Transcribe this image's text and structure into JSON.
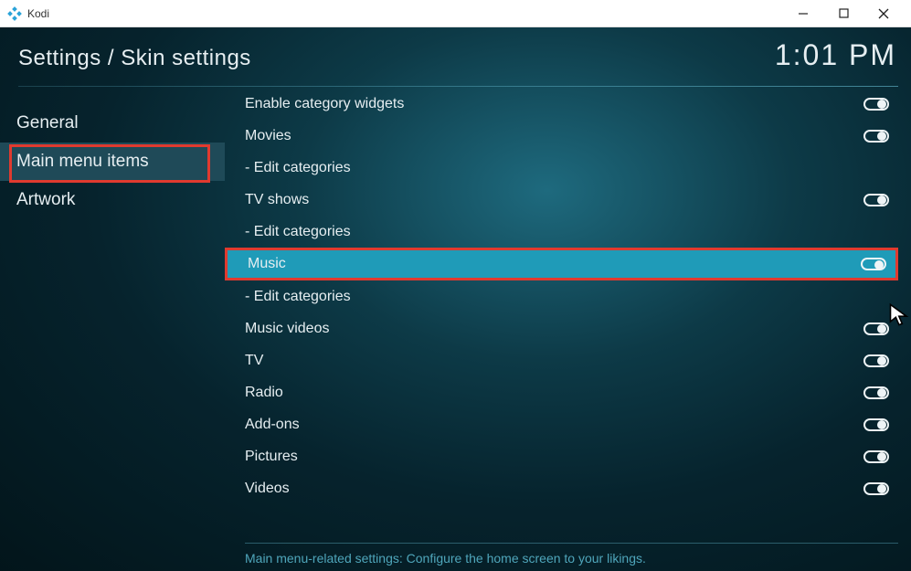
{
  "window": {
    "app_name": "Kodi"
  },
  "breadcrumb": "Settings / Skin settings",
  "clock": "1:01 PM",
  "sidebar": {
    "items": [
      {
        "label": "General",
        "name": "sidebar-item-general",
        "active": false
      },
      {
        "label": "Main menu items",
        "name": "sidebar-item-main-menu-items",
        "active": true
      },
      {
        "label": "Artwork",
        "name": "sidebar-item-artwork",
        "active": false
      }
    ]
  },
  "rows": [
    {
      "label": "Enable category widgets",
      "name": "row-enable-category-widgets",
      "toggle": "on"
    },
    {
      "label": "Movies",
      "name": "row-movies",
      "toggle": "on"
    },
    {
      "label": "- Edit categories",
      "name": "row-edit-categories-movies",
      "toggle": null
    },
    {
      "label": "TV shows",
      "name": "row-tv-shows",
      "toggle": "on"
    },
    {
      "label": "- Edit categories",
      "name": "row-edit-categories-tvshows",
      "toggle": null
    },
    {
      "label": "Music",
      "name": "row-music",
      "toggle": "on",
      "selected": true
    },
    {
      "label": "- Edit categories",
      "name": "row-edit-categories-music",
      "toggle": null
    },
    {
      "label": "Music videos",
      "name": "row-music-videos",
      "toggle": "on"
    },
    {
      "label": "TV",
      "name": "row-tv",
      "toggle": "on"
    },
    {
      "label": "Radio",
      "name": "row-radio",
      "toggle": "on"
    },
    {
      "label": "Add-ons",
      "name": "row-add-ons",
      "toggle": "on"
    },
    {
      "label": "Pictures",
      "name": "row-pictures",
      "toggle": "on"
    },
    {
      "label": "Videos",
      "name": "row-videos",
      "toggle": "on"
    }
  ],
  "footer": "Main menu-related settings: Configure the home screen to your likings."
}
